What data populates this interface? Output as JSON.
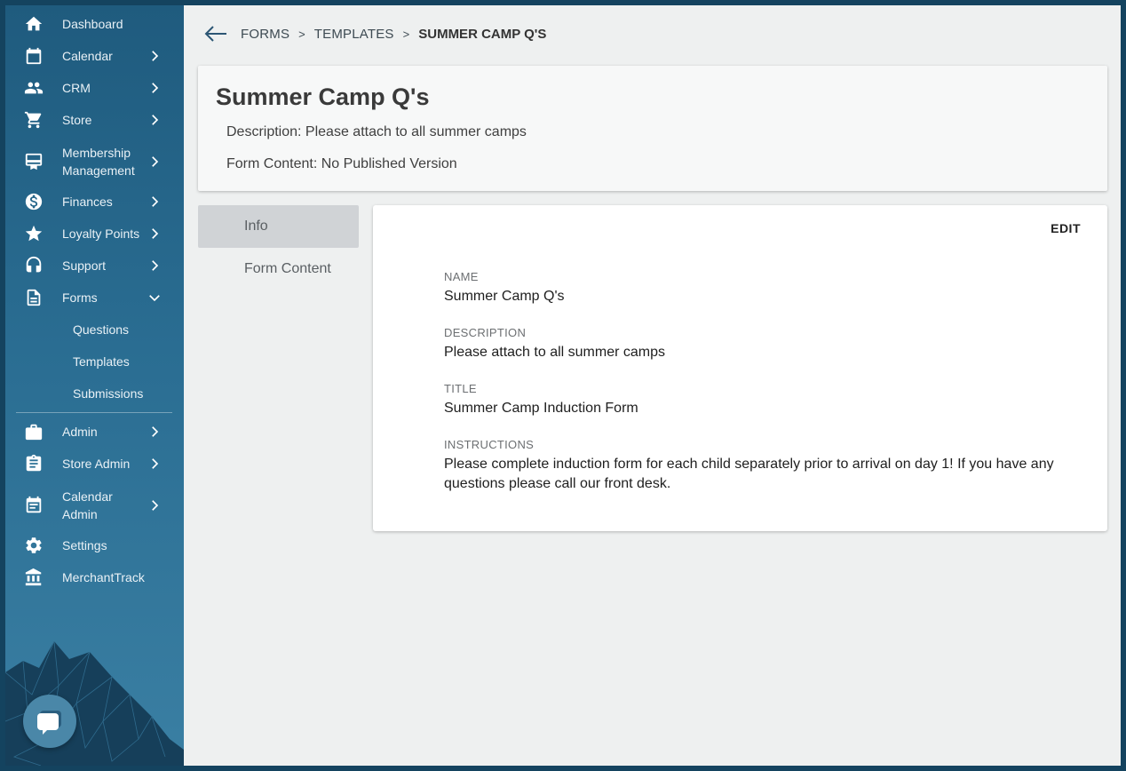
{
  "sidebar": {
    "items": [
      {
        "label": "Dashboard",
        "icon": "home-icon"
      },
      {
        "label": "Calendar",
        "icon": "calendar-icon"
      },
      {
        "label": "CRM",
        "icon": "people-icon"
      },
      {
        "label": "Store",
        "icon": "cart-icon"
      },
      {
        "label": "Membership",
        "label2": "Management",
        "icon": "card-membership-icon"
      },
      {
        "label": "Finances",
        "icon": "dollar-circle-icon"
      },
      {
        "label": "Loyalty Points",
        "icon": "star-icon"
      },
      {
        "label": "Support",
        "icon": "headset-icon"
      },
      {
        "label": "Forms",
        "icon": "document-icon"
      }
    ],
    "forms_sub": [
      "Questions",
      "Templates",
      "Submissions"
    ],
    "admin_items": [
      {
        "label": "Admin",
        "icon": "briefcase-icon"
      },
      {
        "label": "Store Admin",
        "icon": "clipboard-icon"
      },
      {
        "label": "Calendar",
        "label2": "Admin",
        "icon": "event-note-icon"
      },
      {
        "label": "Settings",
        "icon": "gear-icon"
      },
      {
        "label": "MerchantTrack",
        "icon": "bank-icon"
      }
    ]
  },
  "breadcrumb": {
    "items": [
      "FORMS",
      "TEMPLATES"
    ],
    "current": "SUMMER CAMP Q'S",
    "separator": ">"
  },
  "header": {
    "title": "Summer Camp Q's",
    "description": "Description: Please attach to all summer camps",
    "form_content": "Form Content: No Published Version"
  },
  "tabs": [
    {
      "label": "Info",
      "active": true
    },
    {
      "label": "Form Content",
      "active": false
    }
  ],
  "info": {
    "edit_label": "EDIT",
    "fields": [
      {
        "label": "NAME",
        "value": "Summer Camp Q's"
      },
      {
        "label": "DESCRIPTION",
        "value": "Please attach to all summer camps"
      },
      {
        "label": "TITLE",
        "value": "Summer Camp Induction Form"
      },
      {
        "label": "INSTRUCTIONS",
        "value": "Please complete induction form for each child separately prior to arrival on day 1! If you have any questions please call our front desk."
      }
    ]
  },
  "colors": {
    "sidebar_top": "#1f5b7e",
    "sidebar_bottom": "#3a7fa3",
    "accent": "#2c5674",
    "main_bg": "#eef0f0"
  }
}
